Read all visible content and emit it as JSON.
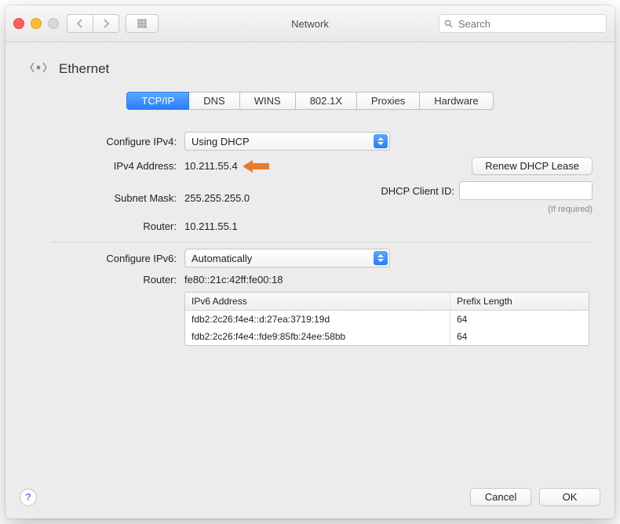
{
  "window": {
    "title": "Network"
  },
  "toolbar": {
    "search_placeholder": "Search"
  },
  "header": {
    "interface": "Ethernet"
  },
  "tabs": [
    "TCP/IP",
    "DNS",
    "WINS",
    "802.1X",
    "Proxies",
    "Hardware"
  ],
  "active_tab": "TCP/IP",
  "ipv4": {
    "configure_label": "Configure IPv4:",
    "configure_value": "Using DHCP",
    "address_label": "IPv4 Address:",
    "address_value": "10.211.55.4",
    "mask_label": "Subnet Mask:",
    "mask_value": "255.255.255.0",
    "router_label": "Router:",
    "router_value": "10.211.55.1",
    "renew_button": "Renew DHCP Lease",
    "client_id_label": "DHCP Client ID:",
    "client_id_hint": "(If required)"
  },
  "ipv6": {
    "configure_label": "Configure IPv6:",
    "configure_value": "Automatically",
    "router_label": "Router:",
    "router_value": "fe80::21c:42ff:fe00:18",
    "cols": {
      "addr": "IPv6 Address",
      "prefix": "Prefix Length"
    },
    "rows": [
      {
        "addr": "fdb2:2c26:f4e4::d:27ea:3719:19d",
        "prefix": "64"
      },
      {
        "addr": "fdb2:2c26:f4e4::fde9:85fb:24ee:58bb",
        "prefix": "64"
      }
    ]
  },
  "footer": {
    "help": "?",
    "cancel": "Cancel",
    "ok": "OK"
  }
}
